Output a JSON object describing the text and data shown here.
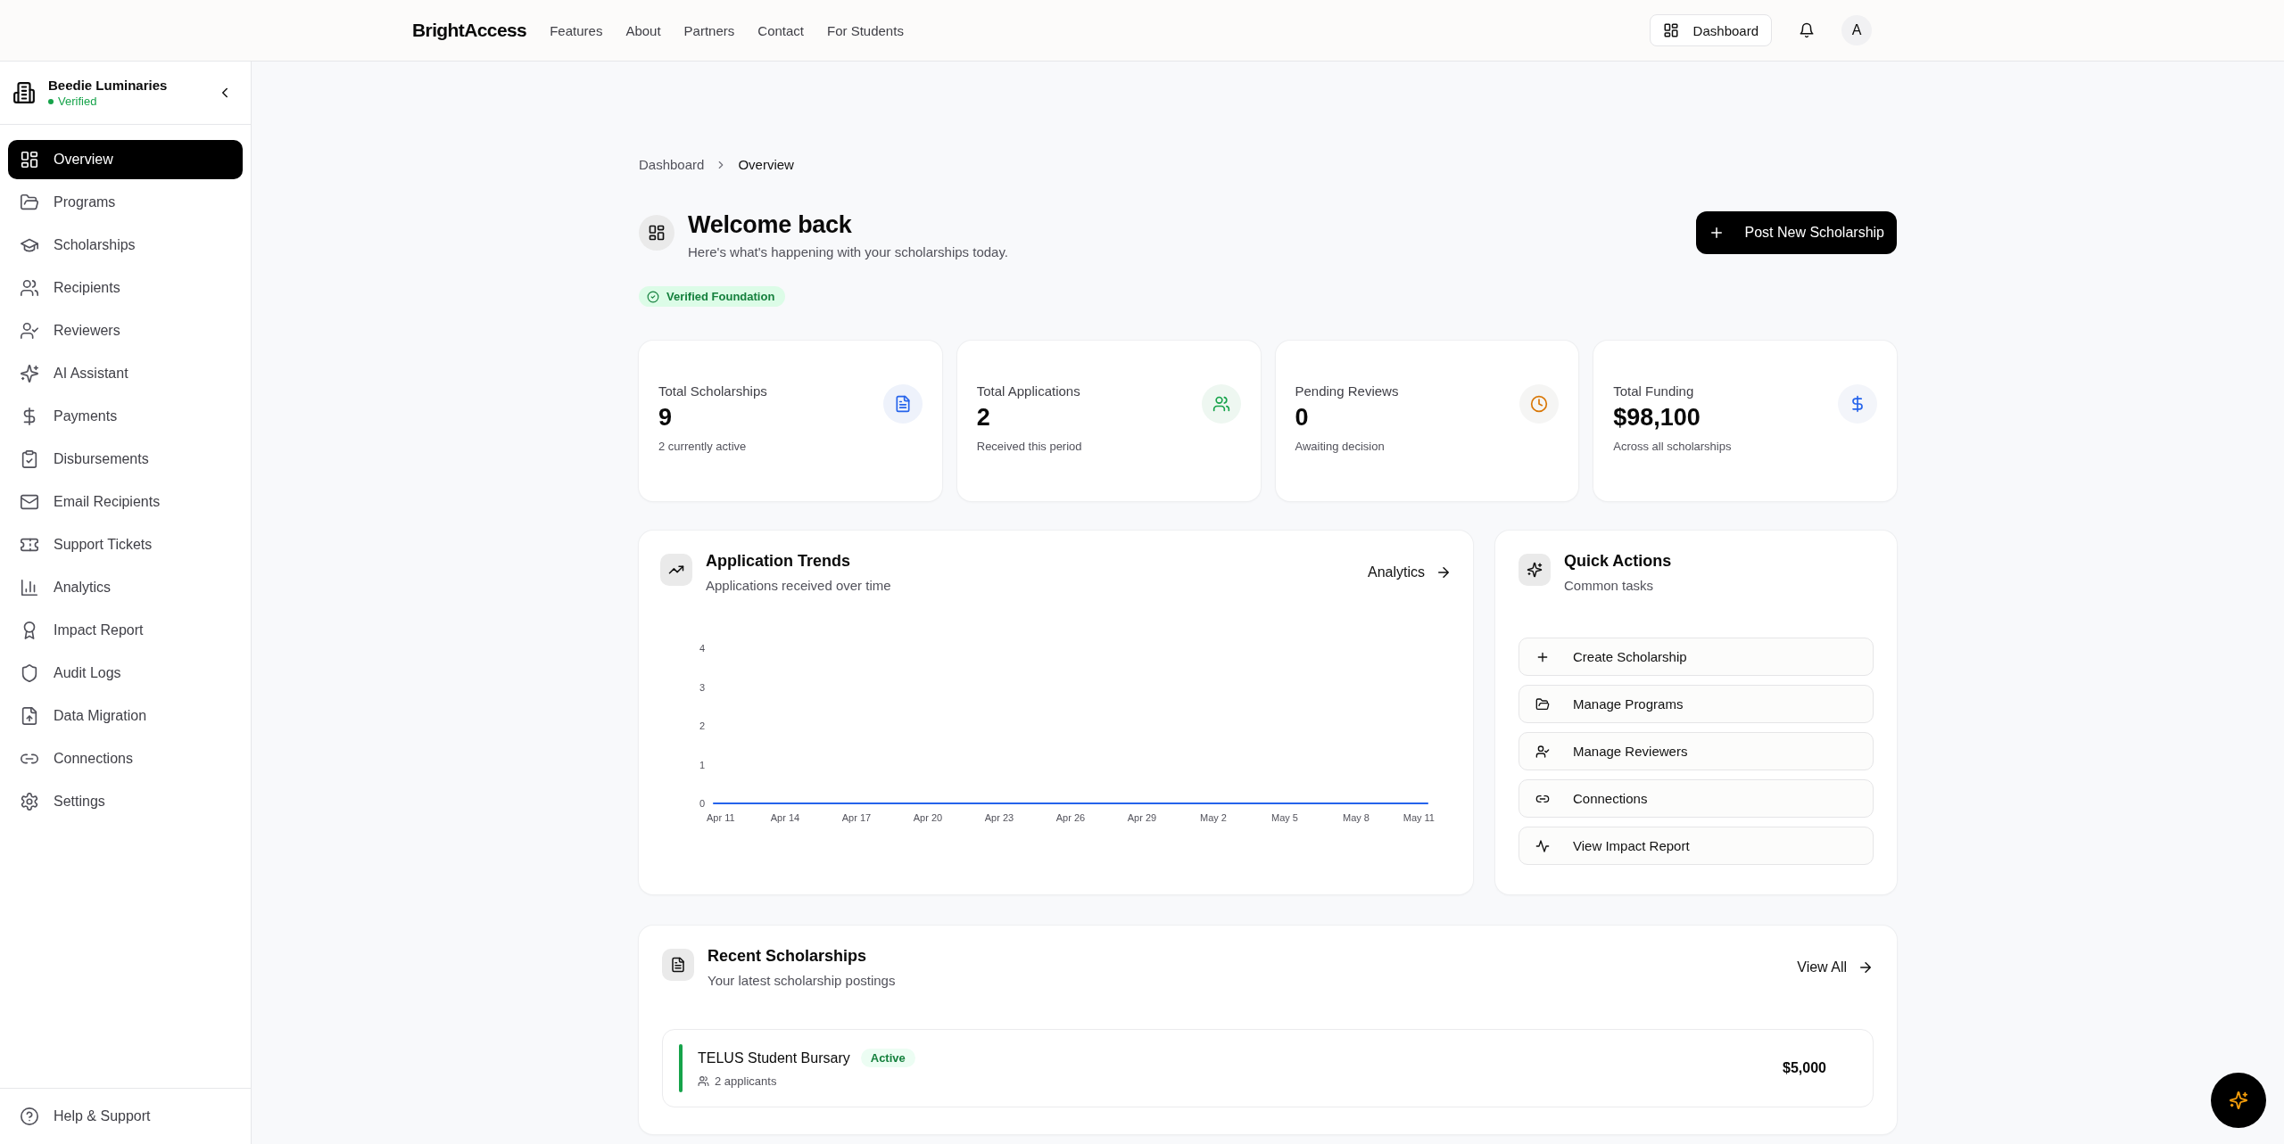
{
  "header": {
    "logo": "BrightAccess",
    "nav": [
      {
        "label": "Features"
      },
      {
        "label": "About"
      },
      {
        "label": "Partners"
      },
      {
        "label": "Contact"
      },
      {
        "label": "For Students"
      }
    ],
    "dashboard_button": "Dashboard",
    "avatar": "A"
  },
  "sidebar": {
    "org_name": "Beedie Luminaries",
    "org_status": "Verified",
    "items": [
      {
        "label": "Overview",
        "selected": true
      },
      {
        "label": "Programs",
        "selected": false
      },
      {
        "label": "Scholarships",
        "selected": false
      },
      {
        "label": "Recipients",
        "selected": false
      },
      {
        "label": "Reviewers",
        "selected": false
      },
      {
        "label": "AI Assistant",
        "selected": false
      },
      {
        "label": "Payments",
        "selected": false
      },
      {
        "label": "Disbursements",
        "selected": false
      },
      {
        "label": "Email Recipients",
        "selected": false
      },
      {
        "label": "Support Tickets",
        "selected": false
      },
      {
        "label": "Analytics",
        "selected": false
      },
      {
        "label": "Impact Report",
        "selected": false
      },
      {
        "label": "Audit Logs",
        "selected": false
      },
      {
        "label": "Data Migration",
        "selected": false
      },
      {
        "label": "Connections",
        "selected": false
      },
      {
        "label": "Settings",
        "selected": false
      }
    ],
    "footer_item": "Help & Support"
  },
  "breadcrumb": [
    "Dashboard",
    "Overview"
  ],
  "welcome": {
    "title": "Welcome back",
    "subtitle": "Here's what's happening with your scholarships today.",
    "action": "Post New Scholarship",
    "badge": "Verified Foundation"
  },
  "stats": [
    {
      "label": "Total Scholarships",
      "value": "9",
      "note": "2 currently active"
    },
    {
      "label": "Total Applications",
      "value": "2",
      "note": "Received this period"
    },
    {
      "label": "Pending Reviews",
      "value": "0",
      "note": "Awaiting decision"
    },
    {
      "label": "Total Funding",
      "value": "$98,100",
      "note": "Across all scholarships"
    }
  ],
  "trends": {
    "title": "Application Trends",
    "subtitle": "Applications received over time",
    "link": "Analytics",
    "chart_data": {
      "type": "line",
      "categories": [
        "Apr 11",
        "Apr 14",
        "Apr 17",
        "Apr 20",
        "Apr 23",
        "Apr 26",
        "Apr 29",
        "May 2",
        "May 5",
        "May 8",
        "May 11"
      ],
      "series": [
        {
          "color": "#2563eb",
          "values": [
            0,
            0,
            0,
            0,
            0,
            0,
            0,
            0,
            0,
            0,
            0
          ]
        }
      ],
      "ylim": [
        0,
        4
      ],
      "yticks": [
        0,
        1,
        2,
        3,
        4
      ]
    }
  },
  "quick_actions": {
    "title": "Quick Actions",
    "subtitle": "Common tasks",
    "actions": [
      "Create Scholarship",
      "Manage Programs",
      "Manage Reviewers",
      "Connections",
      "View Impact Report"
    ]
  },
  "recent": {
    "title": "Recent Scholarships",
    "subtitle": "Your latest scholarship postings",
    "link": "View All",
    "rows": [
      {
        "name": "TELUS Student Bursary",
        "status": "Active",
        "applicants": "2 applicants",
        "amount": "$5,000",
        "color": "#16a34a"
      }
    ]
  }
}
